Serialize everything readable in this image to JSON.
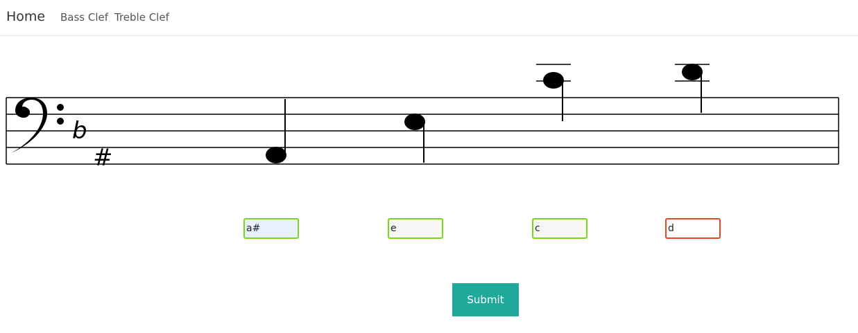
{
  "navbar": {
    "brand": "Home",
    "links": [
      {
        "label": "Bass Clef"
      },
      {
        "label": "Treble Clef"
      }
    ]
  },
  "staff": {
    "clef": "bass-clef-icon",
    "key_signature": [
      "b",
      "#"
    ]
  },
  "answers": [
    {
      "value": "a#",
      "status": "correct"
    },
    {
      "value": "e",
      "status": "correct"
    },
    {
      "value": "c",
      "status": "correct"
    },
    {
      "value": "d",
      "status": "incorrect"
    }
  ],
  "submit_label": "Submit",
  "colors": {
    "correct_border": "#7ed321",
    "incorrect_border": "#e04a1f",
    "submit_bg": "#1fa99b"
  }
}
